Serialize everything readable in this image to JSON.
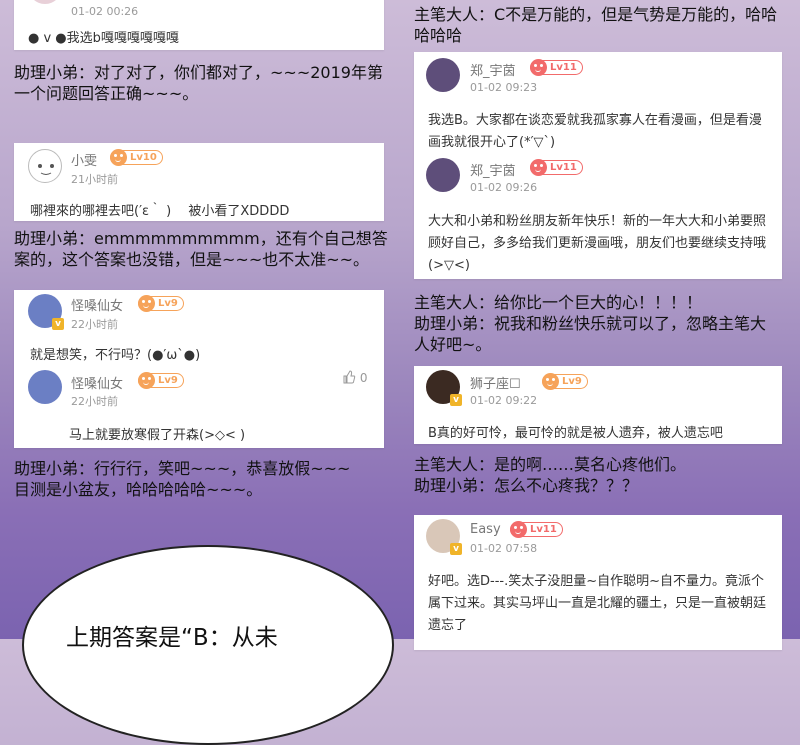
{
  "colors": {
    "level_badge": "#f26b6b",
    "level_badge_alt": "#f6a35a",
    "verified_badge": "#f0b429"
  },
  "card1": {
    "time": "01-02 00:26",
    "text": "● v ●我选b嘎嘎嘎嘎嘎嘎"
  },
  "narr1": "助理小弟：对了对了，你们都对了，~~~2019年第一个问题回答正确~~~。",
  "card2": {
    "name": "小雯",
    "level": "Lv10",
    "time": "21小时前",
    "text": "哪裡來的哪裡去吧(′ε｀ )　 被小看了XDDDD"
  },
  "narr2": "助理小弟：emmmmmmmmmm，还有个自己想答案的，这个答案也没错，但是~~~也不太准~~。",
  "card3": {
    "name": "怪嗓仙女",
    "level": "Lv9",
    "time": "22小时前",
    "text": "就是想笑，不行吗？(●′ω`●)",
    "reply_name": "怪嗓仙女",
    "reply_level": "Lv9",
    "reply_time": "22小时前",
    "reply_likes": "0",
    "reply_text": "马上就要放寒假了开森(>◇< )"
  },
  "narr3": "助理小弟：行行行，笑吧~~~，恭喜放假~~~目测是小盆友，哈哈哈哈哈~~~。",
  "bubble_text": "上期答案是“B：从未",
  "narr_r1": "主笔大人：C不是万能的，但是气势是万能的，哈哈哈哈哈",
  "card4": {
    "name": "郑_宇茵",
    "level": "Lv11",
    "time": "01-02 09:23",
    "text": "我选B。大家都在谈恋爱就我孤家寡人在看漫画，但是看漫画我就很开心了(*′▽`)",
    "reply_name": "郑_宇茵",
    "reply_level": "Lv11",
    "reply_time": "01-02 09:26",
    "reply_text": "大大和小弟和粉丝朋友新年快乐！新的一年大大和小弟要照顾好自己，多多给我们更新漫画哦，朋友们也要继续支持哦(>▽<)"
  },
  "narr_r2": "主笔大人：给你比一个巨大的心！！！！\n助理小弟：祝我和粉丝快乐就可以了，忽略主笔大人好吧~。",
  "card5": {
    "name": "狮子座☐",
    "level": "Lv9",
    "time": "01-02 09:22",
    "text": "B真的好可怜，最可怜的就是被人遗弃，被人遗忘吧"
  },
  "narr_r3": "主笔大人：是的啊……莫名心疼他们。\n助理小弟：怎么不心疼我？？？",
  "card6": {
    "name": "Easy",
    "level": "Lv11",
    "time": "01-02 07:58",
    "text": "好吧。选D---.笑太子没胆量~自作聪明~自不量力。竟派个属下过来。其实马坪山一直是北耀的疆土，只是一直被朝廷遗忘了"
  }
}
